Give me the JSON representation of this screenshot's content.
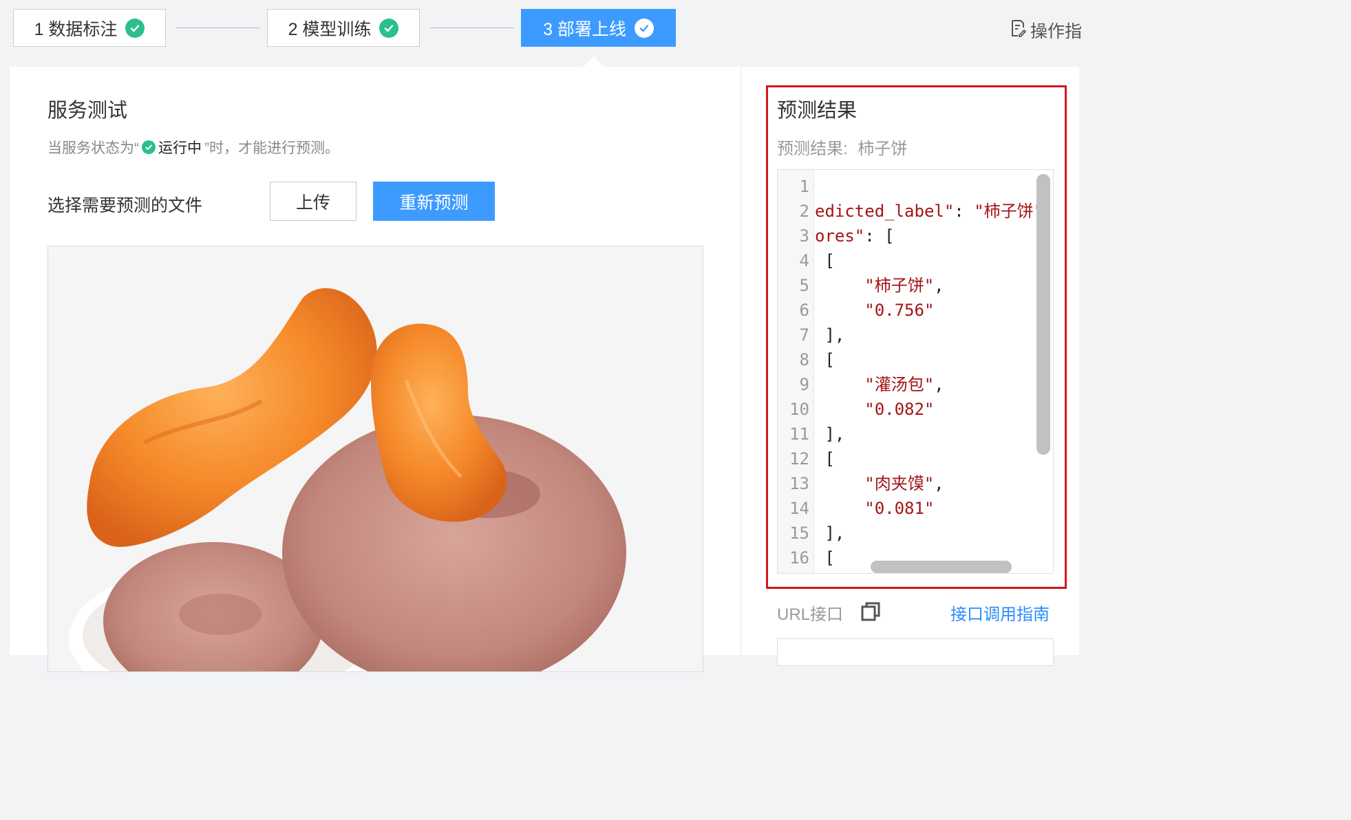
{
  "steps": [
    {
      "label": "1 数据标注"
    },
    {
      "label": "2 模型训练"
    },
    {
      "label": "3 部署上线"
    }
  ],
  "operation_guide": "操作指",
  "service_test": {
    "title": "服务测试",
    "status_prefix": "当服务状态为“",
    "status_running": "运行中",
    "status_suffix": "”时，才能进行预测。",
    "select_file_label": "选择需要预测的文件",
    "upload_button": "上传",
    "repredict_button": "重新预测"
  },
  "result": {
    "title": "预测结果",
    "label_prefix": "预测结果:",
    "label_value": "柿子饼",
    "code_lines": [
      {
        "num": "1",
        "segments": [
          {
            "t": "",
            "s": false
          }
        ]
      },
      {
        "num": "2",
        "segments": [
          {
            "t": "edicted_label\"",
            "s": true
          },
          {
            "t": ": ",
            "s": false
          },
          {
            "t": "\"柿子饼\"",
            "s": true
          }
        ]
      },
      {
        "num": "3",
        "segments": [
          {
            "t": "ores\"",
            "s": true
          },
          {
            "t": ": [",
            "s": false
          }
        ]
      },
      {
        "num": "4",
        "segments": [
          {
            "t": " [",
            "s": false
          }
        ]
      },
      {
        "num": "5",
        "segments": [
          {
            "t": "     ",
            "s": false
          },
          {
            "t": "\"柿子饼\"",
            "s": true
          },
          {
            "t": ",",
            "s": false
          }
        ]
      },
      {
        "num": "6",
        "segments": [
          {
            "t": "     ",
            "s": false
          },
          {
            "t": "\"0.756\"",
            "s": true
          }
        ]
      },
      {
        "num": "7",
        "segments": [
          {
            "t": " ],",
            "s": false
          }
        ]
      },
      {
        "num": "8",
        "segments": [
          {
            "t": " [",
            "s": false
          }
        ]
      },
      {
        "num": "9",
        "segments": [
          {
            "t": "     ",
            "s": false
          },
          {
            "t": "\"灌汤包\"",
            "s": true
          },
          {
            "t": ",",
            "s": false
          }
        ]
      },
      {
        "num": "10",
        "segments": [
          {
            "t": "     ",
            "s": false
          },
          {
            "t": "\"0.082\"",
            "s": true
          }
        ]
      },
      {
        "num": "11",
        "segments": [
          {
            "t": " ],",
            "s": false
          }
        ]
      },
      {
        "num": "12",
        "segments": [
          {
            "t": " [",
            "s": false
          }
        ]
      },
      {
        "num": "13",
        "segments": [
          {
            "t": "     ",
            "s": false
          },
          {
            "t": "\"肉夹馍\"",
            "s": true
          },
          {
            "t": ",",
            "s": false
          }
        ]
      },
      {
        "num": "14",
        "segments": [
          {
            "t": "     ",
            "s": false
          },
          {
            "t": "\"0.081\"",
            "s": true
          }
        ]
      },
      {
        "num": "15",
        "segments": [
          {
            "t": " ],",
            "s": false
          }
        ]
      },
      {
        "num": "16",
        "segments": [
          {
            "t": " [",
            "s": false
          }
        ]
      }
    ]
  },
  "url_section": {
    "label": "URL接口",
    "guide_link": "接口调用指南"
  },
  "colors": {
    "primary": "#3d9bff",
    "success": "#2bbf8e",
    "highlight_border": "#d61518",
    "string": "#a31515",
    "link": "#2b8cff"
  },
  "icons": [
    "check-circle-icon",
    "document-edit-icon",
    "copy-icon"
  ]
}
